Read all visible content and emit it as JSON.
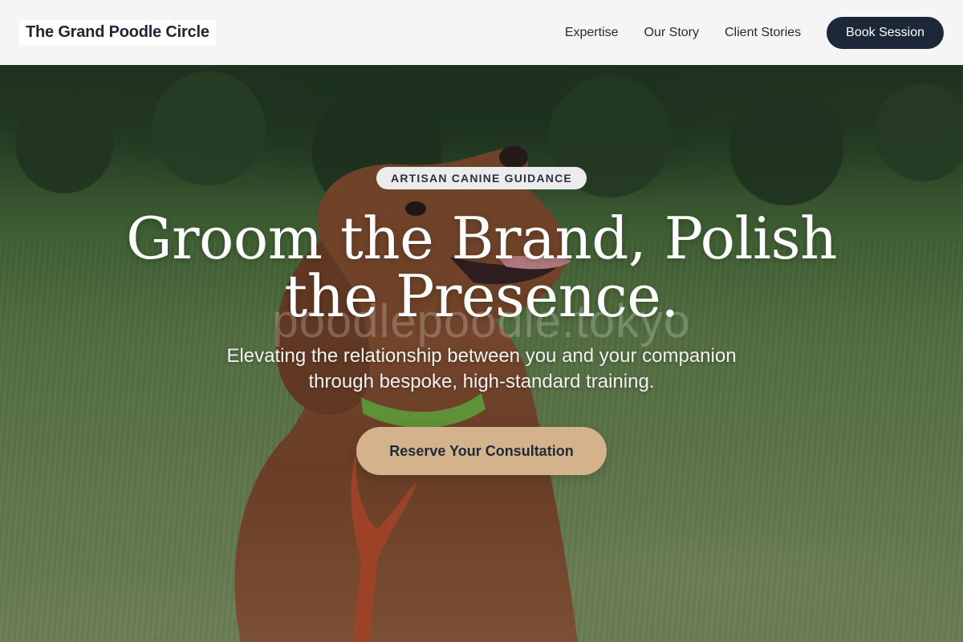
{
  "nav": {
    "brand": "The Grand Poodle Circle",
    "links": [
      "Expertise",
      "Our Story",
      "Client Stories"
    ],
    "cta": "Book Session"
  },
  "hero": {
    "badge": "ARTISAN CANINE GUIDANCE",
    "headline_line1": "Groom the Brand, Polish",
    "headline_line2": "the Presence.",
    "watermark": "poodlepoodle.tokyo",
    "subtitle_line1": "Elevating the relationship between you and your companion",
    "subtitle_line2": "through bespoke, high-standard training.",
    "cta": "Reserve Your Consultation"
  },
  "colors": {
    "nav_background": "#f5f5f5",
    "nav_cta_background": "#1c2738",
    "badge_background": "#ececec",
    "hero_cta_background": "#d4b28c",
    "text_dark": "#1f2937"
  }
}
